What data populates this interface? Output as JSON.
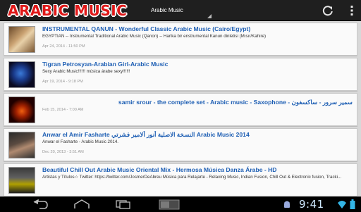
{
  "app": {
    "logo_text": "ARABIC MUSIC",
    "spinner_label": "Arabic Music",
    "icons": {
      "refresh": "refresh-icon",
      "overflow": "overflow-menu-icon"
    },
    "colors": {
      "logo": "#e01818",
      "title_link": "#1e5fb4",
      "actionbar": "#1f1f1f"
    }
  },
  "feed": [
    {
      "title": "INSTRUMENTAL QANUN - Wonderful Classic Arabic Music (Cairo/Egypt)",
      "desc": "EGYPTIAN -- Instrumental Traditional Arabic Music (Qanon) -- Harika bir enstrumental Kanun dinletisi (Mısır/Kahire)",
      "date": "Apr 24, 2014 - 11:50 PM"
    },
    {
      "title": "Tigran Petrosyan-Arabian Girl-Arabic Music",
      "desc": "Sexy Arabic Music!!!!!! música árabe sexy!!!!!!",
      "date": "Apr 19, 2014 - 9:18 PM"
    },
    {
      "title": "samir srour - the complete set - Arabic music - Saxophone - سمير سرور - ساكسفون",
      "desc": "",
      "date": "Feb 15, 2014 - 7:00 AM"
    },
    {
      "title": "Anwar el Amir Fasharte النسخة الاصلية أنور ألامير فشرتي Arabic Music 2014",
      "desc": "Anwar el Fasharte - Arabic Music 2014.",
      "date": "Dec 20, 2013 - 3:51 AM"
    },
    {
      "title": "Beautiful Chill Out Arabic Music Oriental Mix - Hermosa Música Danza Árabe - HD",
      "desc": "Artistas y Títulos☆ Twitter: https://twitter.com/JosmerDeAbreu Música para Relajarte - Relaxing Music, Indian Fusion, Chill Out & Electronic fusion, Tracki...",
      "date": ""
    }
  ],
  "status": {
    "clock": "9:41",
    "icons": [
      "back-icon",
      "home-icon",
      "recent-apps-icon",
      "gallery-notification-icon",
      "android-notification-icon",
      "wifi-icon",
      "battery-icon"
    ]
  }
}
